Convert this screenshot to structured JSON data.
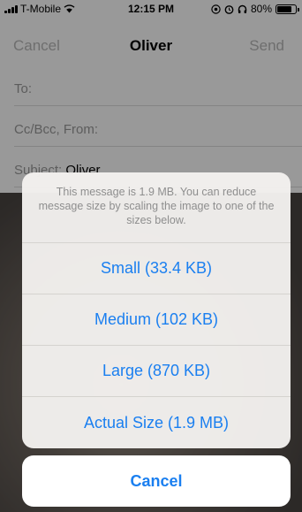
{
  "status_bar": {
    "carrier": "T-Mobile",
    "time": "12:15 PM",
    "battery_percent": "80%",
    "battery_level": 0.8,
    "icons": [
      "signal-icon",
      "wifi-icon",
      "at-icon",
      "alarm-icon",
      "headphones-icon",
      "battery-icon"
    ]
  },
  "compose": {
    "cancel_label": "Cancel",
    "title": "Oliver",
    "send_label": "Send",
    "to_label": "To:",
    "ccbcc_label": "Cc/Bcc, From:",
    "subject_label": "Subject:",
    "subject_value": "Oliver"
  },
  "action_sheet": {
    "message": "This message is 1.9 MB. You can reduce message size by scaling the image to one of the sizes below.",
    "options": [
      {
        "label": "Small (33.4 KB)"
      },
      {
        "label": "Medium (102 KB)"
      },
      {
        "label": "Large (870 KB)"
      },
      {
        "label": "Actual Size (1.9 MB)"
      }
    ],
    "cancel_label": "Cancel"
  },
  "colors": {
    "accent": "#1a7ff0",
    "dim_overlay": "rgba(0,0,0,0.40)"
  }
}
